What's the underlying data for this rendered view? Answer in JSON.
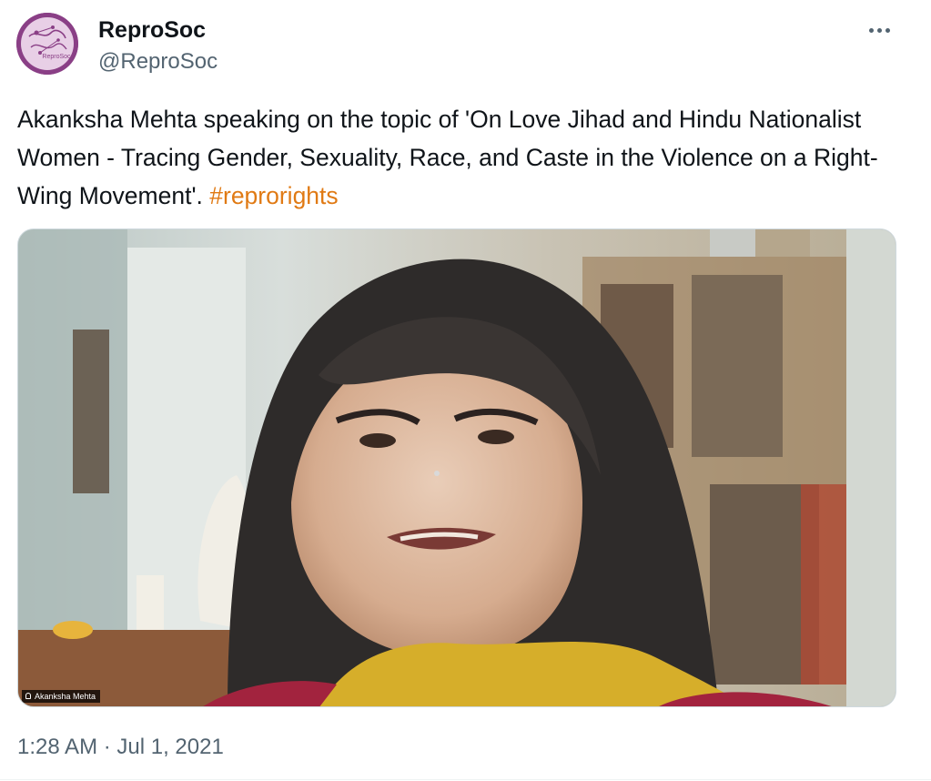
{
  "author": {
    "name": "ReproSoc",
    "handle": "@ReproSoc",
    "avatar_text": "ReproSoc",
    "avatar_color": "#8a3f86"
  },
  "more_icon": "more-horizontal-icon",
  "tweet": {
    "text_main": "Akanksha Mehta speaking on the topic of 'On Love Jihad and Hindu Nationalist Women - Tracing Gender, Sexuality, Race, and Caste in the Violence on a Right-Wing Movement'. ",
    "hashtag": "#reprorights",
    "hashtag_color": "#e07a14"
  },
  "media": {
    "caption": "Akanksha Mehta"
  },
  "timestamp": {
    "time": "1:28 AM",
    "separator": " · ",
    "date": "Jul 1, 2021"
  }
}
